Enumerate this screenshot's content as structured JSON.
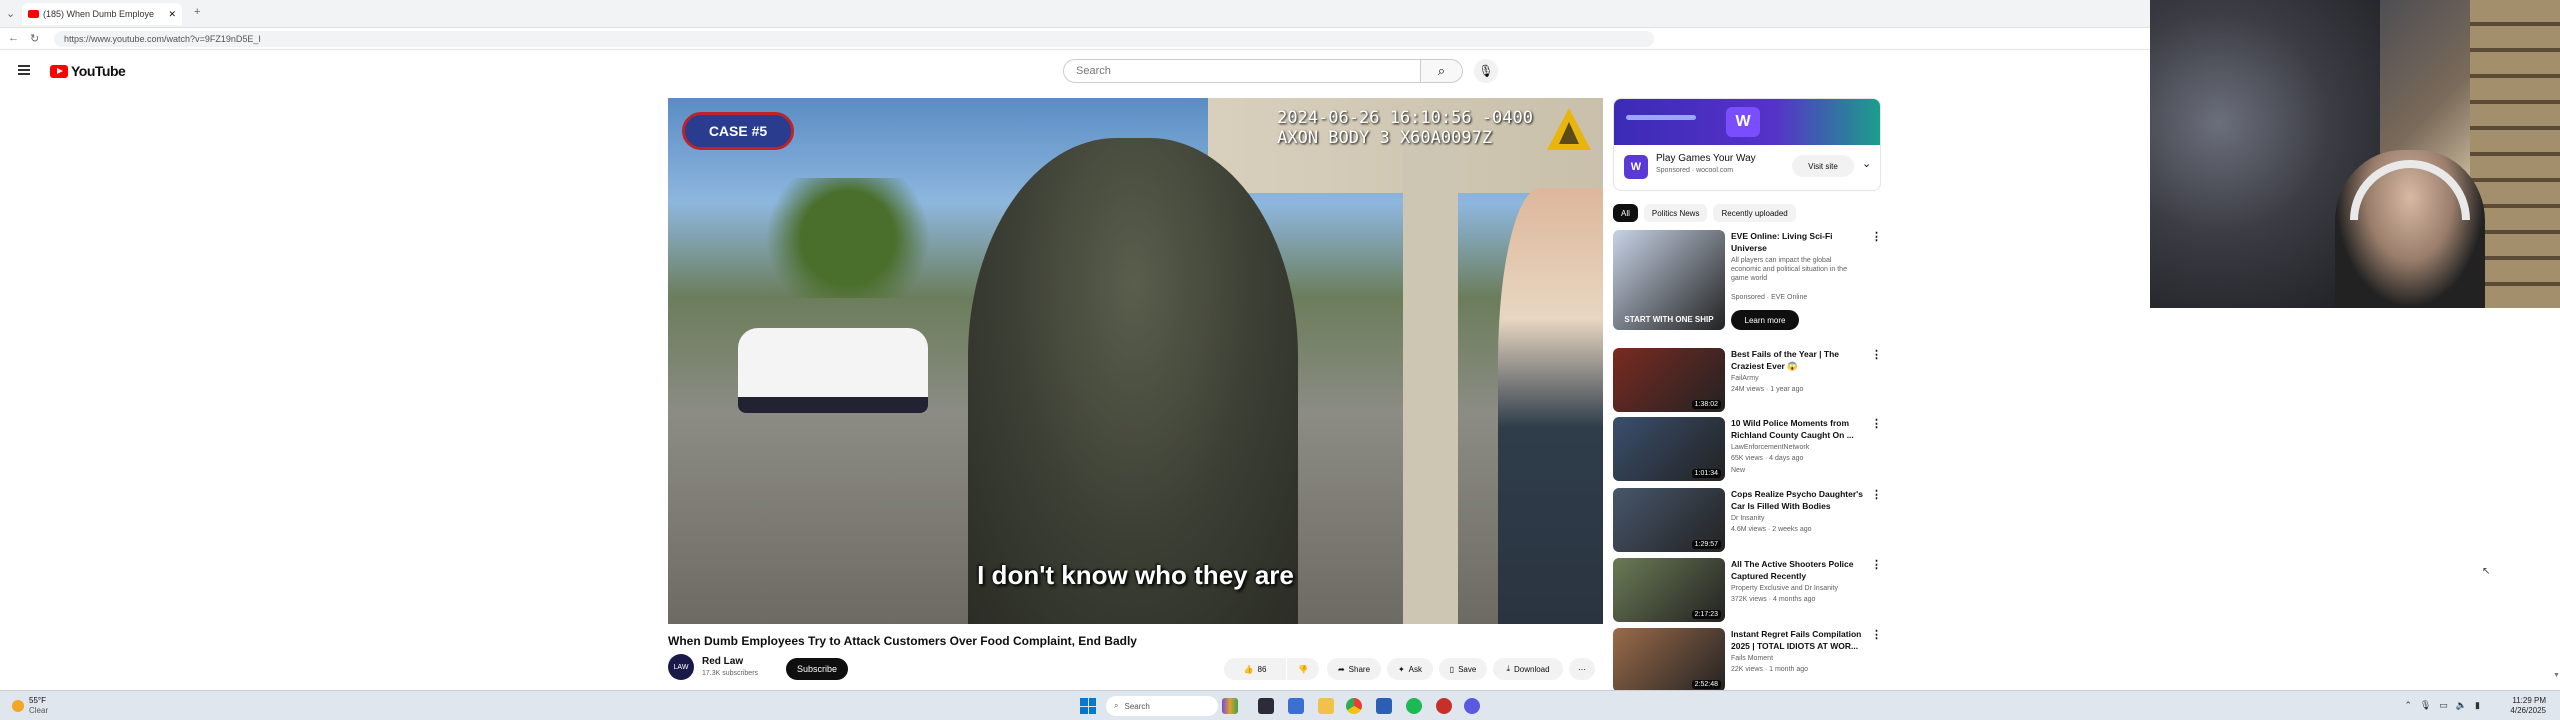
{
  "browser": {
    "tab_title": "(185) When Dumb Employe",
    "url": "https://www.youtube.com/watch?v=9FZ19nD5E_I"
  },
  "youtube": {
    "logo": "YouTube",
    "search_placeholder": "Search"
  },
  "video": {
    "case_label": "CASE #5",
    "timestamp_line1": "2024-06-26 16:10:56 -0400",
    "timestamp_line2": "AXON BODY 3 X60A0097Z",
    "subtitle": "I don't know who they are",
    "title": "When Dumb Employees Try to Attack Customers Over Food Complaint, End Badly",
    "channel": "Red Law",
    "channel_avatar": "LAW",
    "subscribers": "17.3K subscribers",
    "subscribe_label": "Subscribe",
    "likes": "86",
    "share_label": "Share",
    "ask_label": "Ask",
    "save_label": "Save",
    "download_label": "Download"
  },
  "ad": {
    "title": "Play Games Your Way",
    "sponsor_line": "Sponsored · wocool.com",
    "visit_label": "Visit site",
    "brand_letter": "W"
  },
  "chips": [
    "All",
    "Politics News",
    "Recently uploaded"
  ],
  "recommendations": [
    {
      "title": "EVE Online: Living Sci-Fi Universe",
      "channel": "All players can impact the global economic and political situation in the game world",
      "meta": "Sponsored · EVE Online",
      "duration": "",
      "thumb_text": "START WITH ONE SHIP",
      "is_ad": true,
      "cta": "Learn more",
      "thumb_color": "#c7d3e6"
    },
    {
      "title": "Best Fails of the Year | The Craziest Ever 😱",
      "channel": "FailArmy",
      "meta": "24M views · 1 year ago",
      "duration": "1:38:02",
      "thumb_text": "",
      "is_ad": false,
      "thumb_color": "#7a2a22"
    },
    {
      "title": "10 Wild Police Moments from Richland County Caught On ...",
      "channel": "LawEnforcementNetwork",
      "meta": "65K views · 4 days ago",
      "new": "New",
      "duration": "1:01:34",
      "thumb_text": "",
      "is_ad": false,
      "thumb_color": "#3a4f6e"
    },
    {
      "title": "Cops Realize Psycho Daughter's Car Is Filled With Bodies",
      "channel": "Dr Insanity",
      "meta": "4.6M views · 2 weeks ago",
      "duration": "1:29:57",
      "thumb_text": "",
      "is_ad": false,
      "thumb_color": "#47566b"
    },
    {
      "title": "All The Active Shooters Police Captured Recently",
      "channel": "Property Exclusive and Dr Insanity",
      "meta": "372K views · 4 months ago",
      "duration": "2:17:23",
      "thumb_text": "",
      "is_ad": false,
      "thumb_color": "#6b7a55"
    },
    {
      "title": "Instant Regret Fails Compilation 2025 | TOTAL IDIOTS AT WOR...",
      "channel": "Fails Moment",
      "meta": "22K views · 1 month ago",
      "duration": "2:52:48",
      "thumb_text": "",
      "is_ad": false,
      "thumb_color": "#9b6b4a"
    }
  ],
  "taskbar": {
    "temperature": "55°F",
    "weather": "Clear",
    "search_label": "Search",
    "time": "11:29 PM",
    "date": "4/26/2025"
  },
  "colors": {
    "yt_red": "#ff0000",
    "case_blue": "#2a3c8d",
    "case_border": "#c0222b"
  }
}
